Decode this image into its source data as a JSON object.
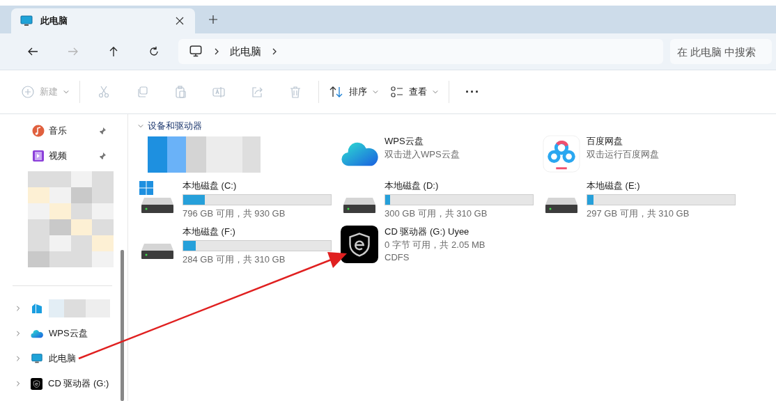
{
  "tab": {
    "title": "此电脑",
    "selected": true
  },
  "nav": {
    "buttons": [
      {
        "kind": "back",
        "disabled": false
      },
      {
        "kind": "forward",
        "disabled": true
      },
      {
        "kind": "up",
        "disabled": false
      },
      {
        "kind": "refresh",
        "disabled": false
      }
    ],
    "path": [
      "此电脑"
    ],
    "search": {
      "placeholder": "在 此电脑 中搜索"
    }
  },
  "toolbar": [
    {
      "kind": "new",
      "label": "新建",
      "disabled": true
    },
    {
      "kind": "cut",
      "disabled": true
    },
    {
      "kind": "copy",
      "disabled": true
    },
    {
      "kind": "paste",
      "disabled": true
    },
    {
      "kind": "rename",
      "disabled": true
    },
    {
      "kind": "share",
      "disabled": true
    },
    {
      "kind": "delete",
      "disabled": true
    },
    {
      "kind": "sort",
      "label": "排序",
      "disabled": false
    },
    {
      "kind": "view",
      "label": "查看",
      "disabled": false
    },
    {
      "kind": "more",
      "label": "···",
      "disabled": false
    }
  ],
  "sidebar": {
    "pinned": [
      {
        "kind": "music",
        "label": "音乐",
        "pinned": true
      },
      {
        "kind": "video",
        "label": "视频",
        "pinned": true
      }
    ],
    "tree": [
      {
        "kind": "redacted",
        "expanded": false
      },
      {
        "kind": "cloud",
        "label": "WPS云盘",
        "expanded": false
      },
      {
        "kind": "pc",
        "label": "此电脑",
        "expanded": false
      },
      {
        "kind": "cd",
        "label": "CD 驱动器 (G:)",
        "expanded": false
      }
    ]
  },
  "section": {
    "title": "设备和驱动器",
    "expanded": true,
    "items": [
      {
        "kind": "redacted"
      },
      {
        "kind": "cloud",
        "name": "WPS云盘",
        "subtitle": "双击进入WPS云盘"
      },
      {
        "kind": "baidu",
        "name": "百度网盘",
        "subtitle": "双击运行百度网盘"
      },
      {
        "kind": "drive",
        "system": true,
        "name": "本地磁盘 (C:)",
        "level": 0.144,
        "info": "796 GB 可用，共 930 GB"
      },
      {
        "kind": "drive",
        "system": false,
        "name": "本地磁盘 (D:)",
        "level": 0.032,
        "info": "300 GB 可用，共 310 GB"
      },
      {
        "kind": "drive",
        "system": false,
        "name": "本地磁盘 (E:)",
        "level": 0.042,
        "info": "297 GB 可用，共 310 GB"
      },
      {
        "kind": "drive",
        "system": false,
        "name": "本地磁盘 (F:)",
        "level": 0.084,
        "info": "284 GB 可用，共 310 GB"
      },
      {
        "kind": "optical",
        "name": "CD 驱动器 (G:) Uyee",
        "info": "0 字节 可用，共 2.05 MB",
        "fs": "CDFS"
      }
    ]
  }
}
